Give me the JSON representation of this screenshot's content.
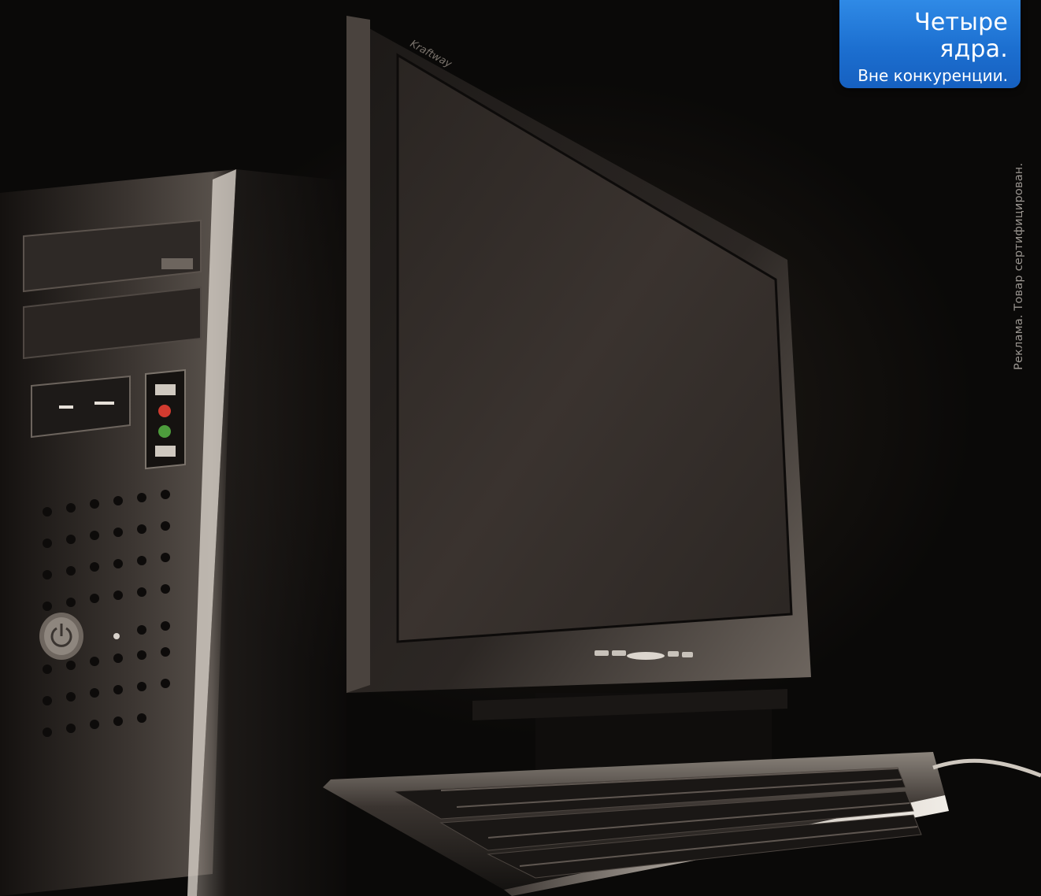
{
  "promo": {
    "headline": "Четыре ядра.",
    "subline": "Вне конкуренции."
  },
  "disclaimer": "Реклама. Товар сертифицирован.",
  "monitor_brand": "Kraftway",
  "colors": {
    "badge_blue": "#1c6fd0",
    "background": "#0a0908",
    "disclaimer_text": "#9a9590"
  }
}
